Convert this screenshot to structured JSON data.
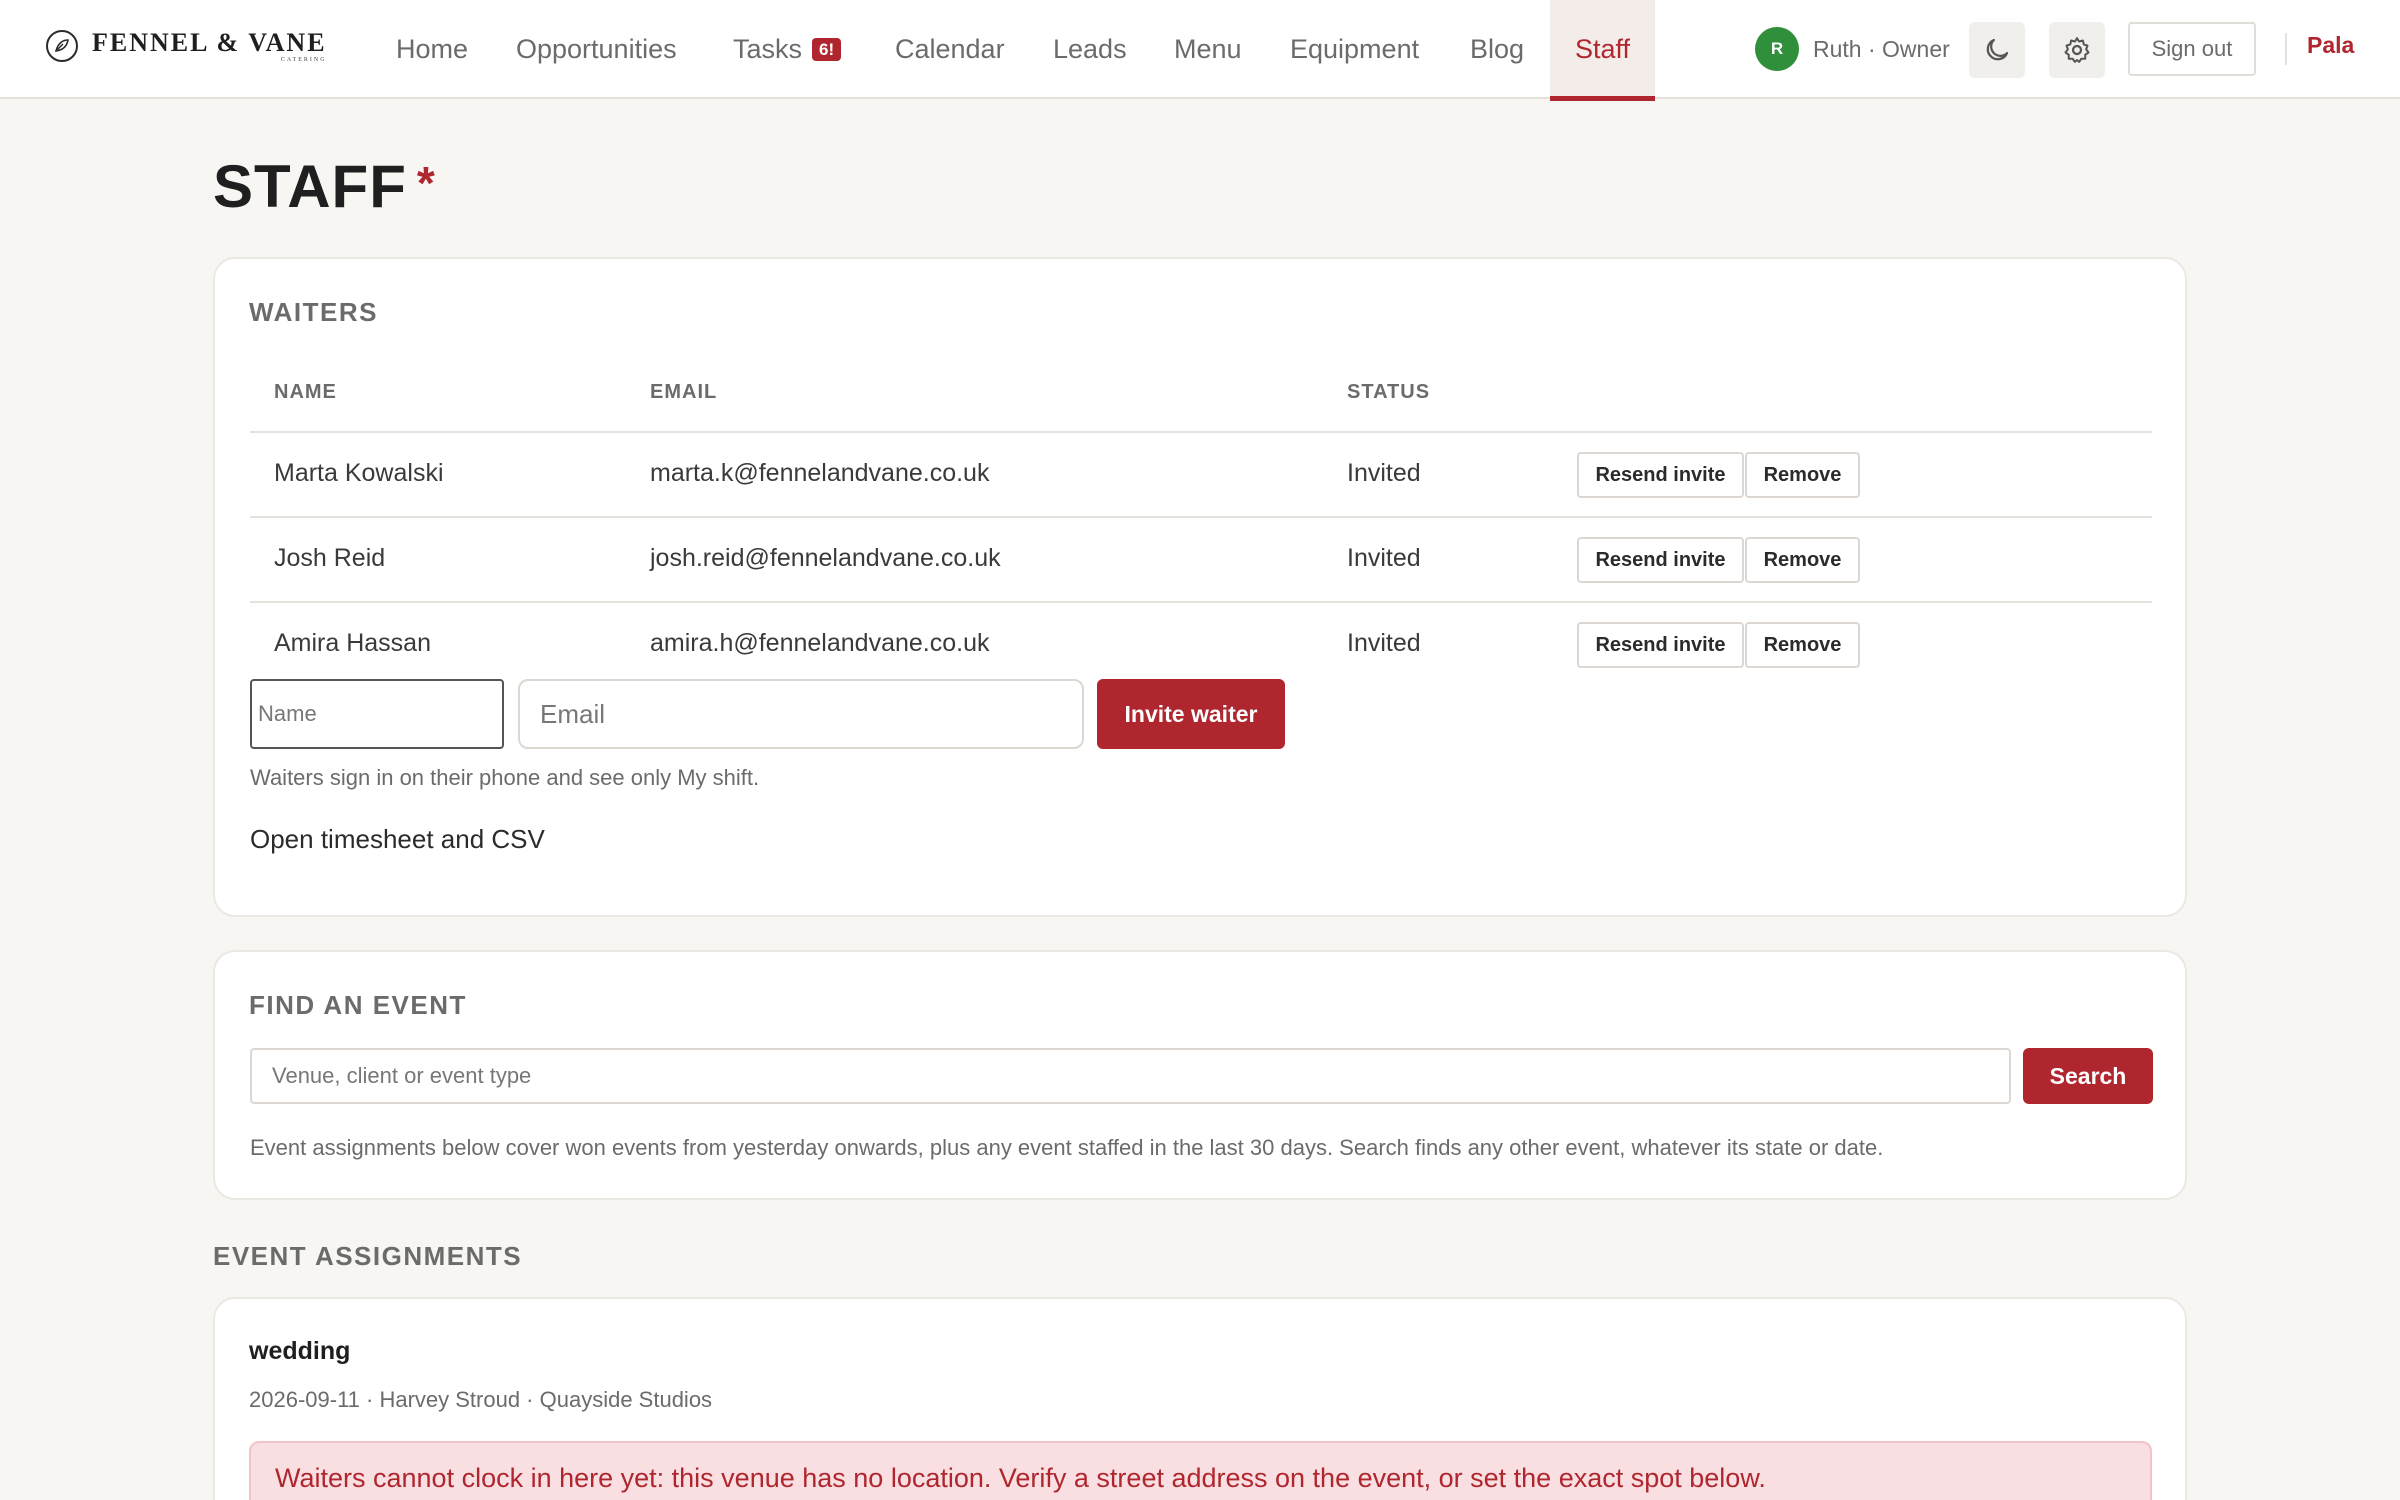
{
  "brand": {
    "name": "FENNEL & VANE",
    "sub": "CATERING"
  },
  "nav": {
    "home": "Home",
    "opportunities": "Opportunities",
    "tasks": "Tasks",
    "tasks_badge": "6!",
    "calendar": "Calendar",
    "leads": "Leads",
    "menu": "Menu",
    "equipment": "Equipment",
    "blog": "Blog",
    "staff": "Staff"
  },
  "user": {
    "initial": "R",
    "name": "Ruth · Owner"
  },
  "header_actions": {
    "theme_icon": "moon-icon",
    "settings_icon": "gear-icon",
    "sign_out": "Sign out",
    "workspace": "Pala"
  },
  "page": {
    "title": "STAFF",
    "required_mark": "*"
  },
  "waiters": {
    "title": "WAITERS",
    "columns": {
      "name": "NAME",
      "email": "EMAIL",
      "status": "STATUS"
    },
    "rows": [
      {
        "name": "Marta Kowalski",
        "email": "marta.k@fennelandvane.co.uk",
        "status": "Invited",
        "resend": "Resend invite",
        "remove": "Remove"
      },
      {
        "name": "Josh Reid",
        "email": "josh.reid@fennelandvane.co.uk",
        "status": "Invited",
        "resend": "Resend invite",
        "remove": "Remove"
      },
      {
        "name": "Amira Hassan",
        "email": "amira.h@fennelandvane.co.uk",
        "status": "Invited",
        "resend": "Resend invite",
        "remove": "Remove"
      }
    ],
    "name_placeholder": "Name",
    "email_placeholder": "Email",
    "invite_button": "Invite waiter",
    "hint": "Waiters sign in on their phone and see only My shift.",
    "timesheet_link": "Open timesheet and CSV"
  },
  "find_event": {
    "title": "FIND AN EVENT",
    "search_placeholder": "Venue, client or event type",
    "search_button": "Search",
    "note": "Event assignments below cover won events from yesterday onwards, plus any event staffed in the last 30 days. Search finds any other event, whatever its state or date."
  },
  "assignments": {
    "title": "EVENT ASSIGNMENTS",
    "event": {
      "type": "wedding",
      "meta": "2026-09-11 · Harvey Stroud · Quayside Studios",
      "alert": "Waiters cannot clock in here yet: this venue has no location. Verify a street address on the event, or set the exact spot below."
    }
  },
  "colors": {
    "accent": "#b0262f",
    "avatar": "#2f8f3a",
    "background": "#f8f6f3",
    "alert_bg": "#f9dfe1"
  }
}
